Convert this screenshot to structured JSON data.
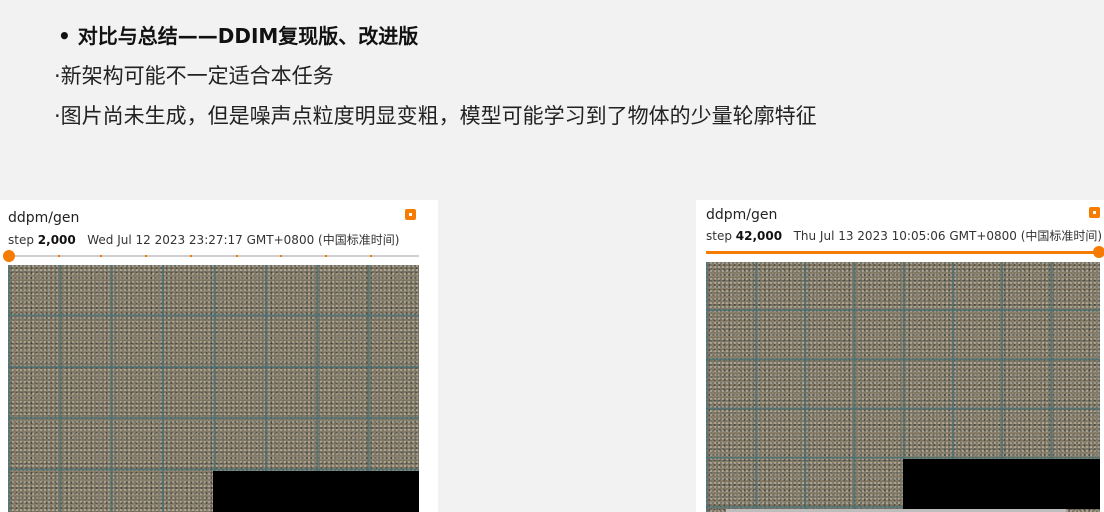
{
  "slide": {
    "title": "• 对比与总结——DDIM复现版、改进版",
    "line1": "·新架构可能不一定适合本任务",
    "line2": "·图片尚未生成，但是噪声点粒度明显变粗，模型可能学习到了物体的少量轮廓特征"
  },
  "panels": [
    {
      "tag": "ddpm/gen",
      "step_label": "step",
      "step_value": "2,000",
      "timestamp": "Wed Jul 12 2023 23:27:17 GMT+0800 (中国标准时间)",
      "slider_position": 0.0
    },
    {
      "tag": "ddpm/gen",
      "step_label": "step",
      "step_value": "42,000",
      "timestamp": "Thu Jul 13 2023 10:05:06 GMT+0800 (中国标准时间)",
      "slider_position": 1.0
    }
  ],
  "colors": {
    "accent": "#f57c00",
    "noise_base": "#7d7563",
    "grid_line": "#466e73"
  },
  "icons": {
    "pin": "pin-icon"
  }
}
